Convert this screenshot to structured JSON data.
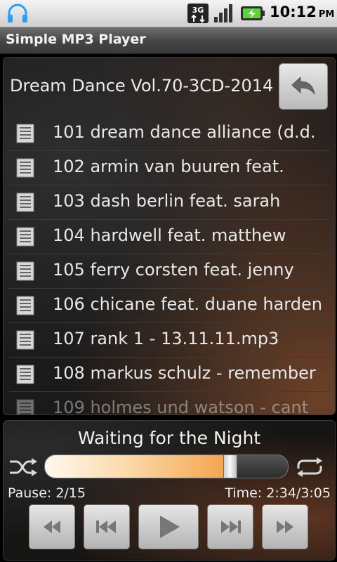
{
  "status_bar": {
    "network": "3G",
    "time": "10:12",
    "ampm": "PM",
    "icons": [
      "headphones-icon",
      "3g-data-icon",
      "signal-icon",
      "battery-charging-icon"
    ]
  },
  "app": {
    "title": "Simple MP3 Player"
  },
  "playlist": {
    "folder": "Dream Dance Vol.70-3CD-2014",
    "tracks": [
      "101 dream dance alliance (d.d.",
      "102 armin van buuren feat.",
      "103 dash berlin feat. sarah",
      "104 hardwell feat. matthew",
      "105 ferry corsten feat. jenny",
      "106 chicane feat. duane harden",
      "107 rank 1 - 13.11.11.mp3",
      "108 markus schulz - remember",
      "109 holmes und watson - cant"
    ]
  },
  "player": {
    "now_playing": "Waiting for the Night",
    "progress": 0.76,
    "pause_label": "Pause: 2/15",
    "time_label": "Time: 2:34/3:05",
    "controls": [
      "rewind",
      "previous",
      "play",
      "next",
      "fast-forward"
    ]
  },
  "colors": {
    "accent": "#f3a24a",
    "panel": "#1b1a1a",
    "button": "#d0d0d0"
  }
}
